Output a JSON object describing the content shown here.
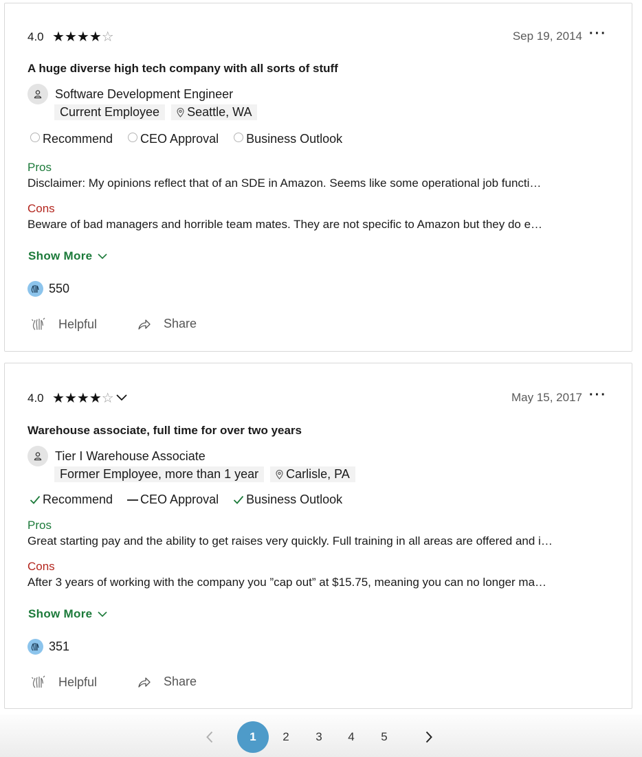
{
  "reviews": [
    {
      "rating": "4.0",
      "stars_filled": 4,
      "stars_total": 5,
      "date": "Sep 19, 2014",
      "title": "A huge diverse high tech company with all sorts of stuff",
      "job_title": "Software Development Engineer",
      "employment_status": "Current Employee",
      "location": "Seattle, WA",
      "indicators": [
        {
          "label": "Recommend",
          "state": "none"
        },
        {
          "label": "CEO Approval",
          "state": "none"
        },
        {
          "label": "Business Outlook",
          "state": "none"
        }
      ],
      "pros_label": "Pros",
      "pros": "Disclaimer: My opinions reflect that of an SDE in Amazon. Seems like some operational job functi…",
      "cons_label": "Cons",
      "cons": "Beware of bad managers and horrible team mates. They are not specific to Amazon but they do e…",
      "show_more": "Show More",
      "helpful_count": "550",
      "helpful_label": "Helpful",
      "share_label": "Share"
    },
    {
      "rating": "4.0",
      "stars_filled": 4,
      "stars_total": 5,
      "date": "May 15, 2017",
      "title": "Warehouse associate, full time for over two years",
      "job_title": "Tier I Warehouse Associate",
      "employment_status": "Former Employee, more than 1 year",
      "location": "Carlisle, PA",
      "indicators": [
        {
          "label": "Recommend",
          "state": "positive"
        },
        {
          "label": "CEO Approval",
          "state": "neutral"
        },
        {
          "label": "Business Outlook",
          "state": "positive"
        }
      ],
      "pros_label": "Pros",
      "pros": "Great starting pay and the ability to get raises very quickly. Full training in all areas are offered and i…",
      "cons_label": "Cons",
      "cons": "After 3 years of working with the company you ”cap out” at $15.75, meaning you can no longer ma…",
      "show_more": "Show More",
      "helpful_count": "351",
      "helpful_label": "Helpful",
      "share_label": "Share"
    }
  ],
  "pagination": {
    "pages": [
      "1",
      "2",
      "3",
      "4",
      "5"
    ],
    "current": "1"
  },
  "colors": {
    "pros": "#1c7a3a",
    "cons": "#b3261e",
    "check": "#1c7a3a",
    "page_active": "#4e9bc9",
    "helpful_badge": "#8cc4ec"
  },
  "icons": {
    "more": "more-horizontal-icon",
    "avatar": "person-icon",
    "location": "location-pin-icon",
    "helpful": "hand-clap-icon",
    "share": "share-arrow-icon",
    "prev": "chevron-left-icon",
    "next": "chevron-right-icon",
    "expand": "chevron-down-icon"
  }
}
